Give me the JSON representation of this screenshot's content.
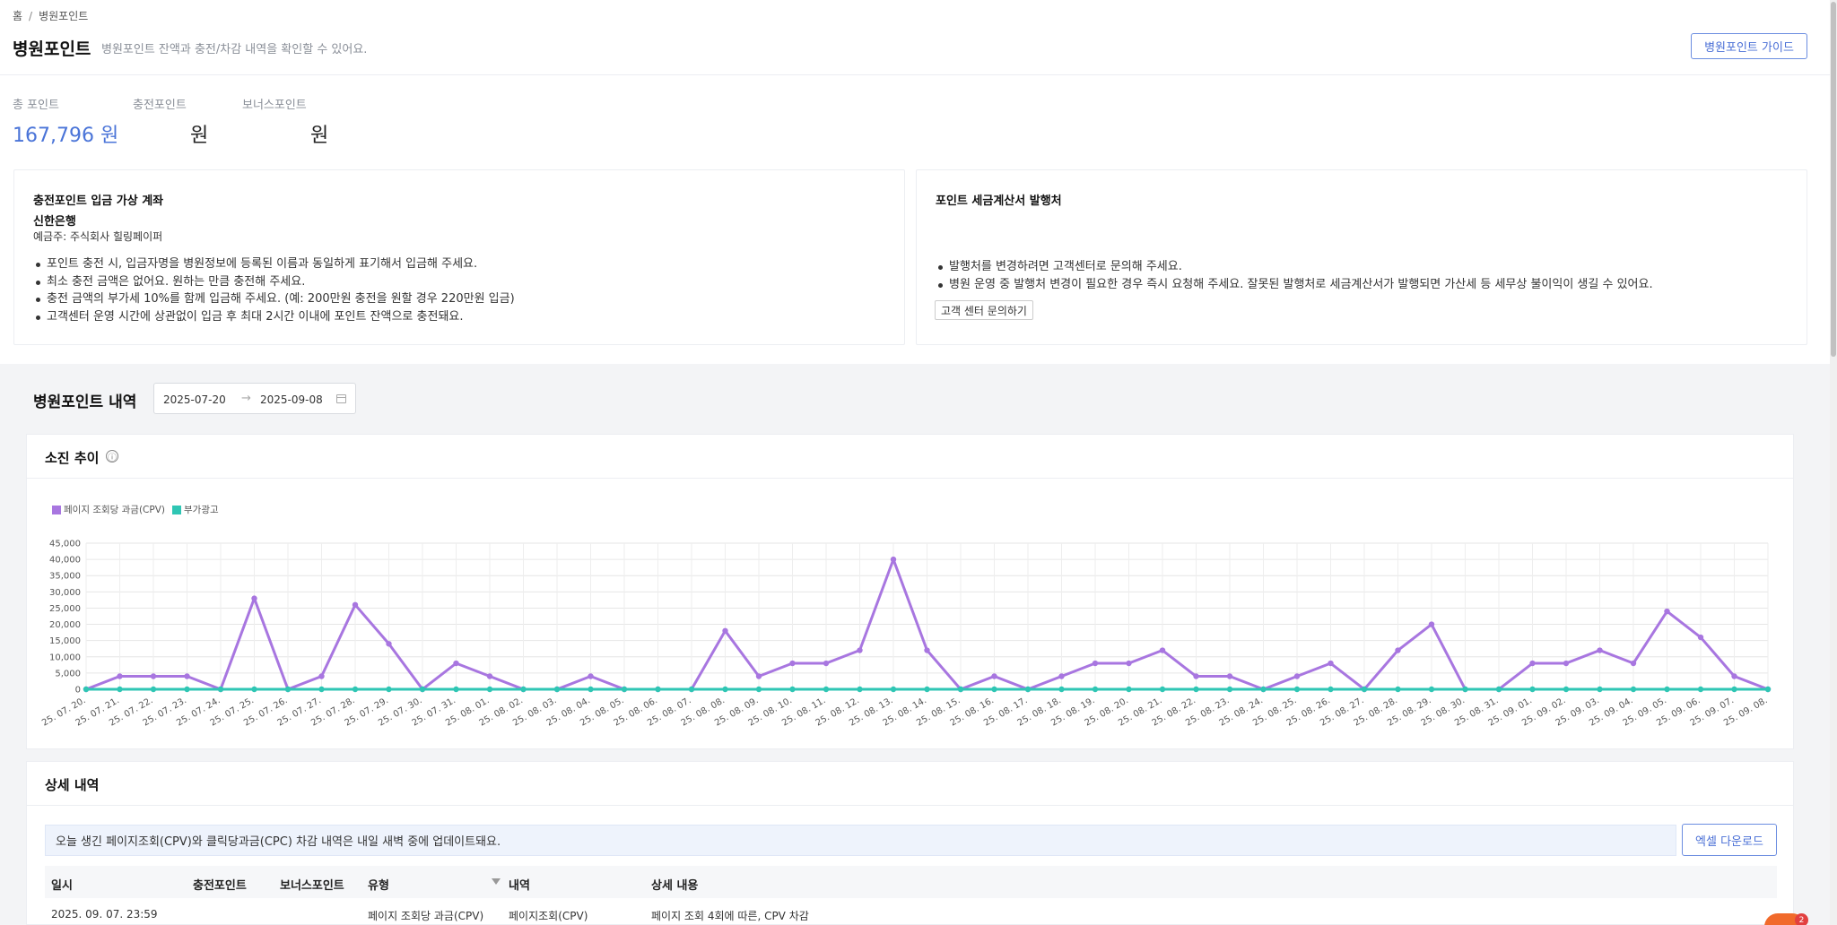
{
  "breadcrumb": {
    "home": "홈",
    "separator": "/",
    "current": "병원포인트"
  },
  "header": {
    "title": "병원포인트",
    "description": "병원포인트 잔액과 충전/차감 내역을 확인할 수 있어요.",
    "guide_button": "병원포인트 가이드"
  },
  "stats": {
    "total_label": "총 포인트",
    "total_value": "167,796 원",
    "charge_label": "충전포인트",
    "charge_value": "원",
    "bonus_label": "보너스포인트",
    "bonus_value": "원"
  },
  "deposit_card": {
    "title": "충전포인트 입금 가상 계좌",
    "bank": "신한은행",
    "holder": "예금주: 주식회사 힐링페이퍼",
    "bullets": [
      "포인트 충전 시, 입금자명을 병원정보에 등록된 이름과 동일하게 표기해서 입금해 주세요.",
      "최소 충전 금액은 없어요. 원하는 만큼 충전해 주세요.",
      "충전 금액의 부가세 10%를 함께 입금해 주세요. (예: 200만원 충전을 원할 경우 220만원 입금)",
      "고객센터 운영 시간에 상관없이 입금 후 최대 2시간 이내에 포인트 잔액으로 충전돼요."
    ]
  },
  "invoice_card": {
    "title": "포인트 세금계산서 발행처",
    "bullets": [
      "발행처를 변경하려면 고객센터로 문의해 주세요.",
      "병원 운영 중 발행처 변경이 필요한 경우 즉시 요청해 주세요. 잘못된 발행처로 세금계산서가 발행되면 가산세 등 세무상 불이익이 생길 수 있어요."
    ],
    "cs_button": "고객 센터 문의하기"
  },
  "history": {
    "title": "병원포인트 내역",
    "date_from": "2025-07-20",
    "date_arrow": "→",
    "date_to": "2025-09-08"
  },
  "trend_panel": {
    "title": "소진 추이",
    "info_icon": "ⓘ"
  },
  "colors": {
    "accent": "#4a74d8",
    "cpv": "#a876e0",
    "addon": "#2fc6b4"
  },
  "chart_data": {
    "type": "line",
    "x": [
      "25. 07. 20.",
      "25. 07. 21.",
      "25. 07. 22.",
      "25. 07. 23.",
      "25. 07. 24.",
      "25. 07. 25.",
      "25. 07. 26.",
      "25. 07. 27.",
      "25. 07. 28.",
      "25. 07. 29.",
      "25. 07. 30.",
      "25. 07. 31.",
      "25. 08. 01.",
      "25. 08. 02.",
      "25. 08. 03.",
      "25. 08. 04.",
      "25. 08. 05.",
      "25. 08. 06.",
      "25. 08. 07.",
      "25. 08. 08.",
      "25. 08. 09.",
      "25. 08. 10.",
      "25. 08. 11.",
      "25. 08. 12.",
      "25. 08. 13.",
      "25. 08. 14.",
      "25. 08. 15.",
      "25. 08. 16.",
      "25. 08. 17.",
      "25. 08. 18.",
      "25. 08. 19.",
      "25. 08. 20.",
      "25. 08. 21.",
      "25. 08. 22.",
      "25. 08. 23.",
      "25. 08. 24.",
      "25. 08. 25.",
      "25. 08. 26.",
      "25. 08. 27.",
      "25. 08. 28.",
      "25. 08. 29.",
      "25. 08. 30.",
      "25. 08. 31.",
      "25. 09. 01.",
      "25. 09. 02.",
      "25. 09. 03.",
      "25. 09. 04.",
      "25. 09. 05.",
      "25. 09. 06.",
      "25. 09. 07.",
      "25. 09. 08."
    ],
    "series": [
      {
        "name": "페이지 조회당 과금(CPV)",
        "color": "#a876e0",
        "values": [
          0,
          4000,
          4000,
          4000,
          0,
          28000,
          0,
          4000,
          26000,
          14000,
          0,
          8000,
          4000,
          0,
          0,
          4000,
          0,
          0,
          0,
          18000,
          4000,
          8000,
          8000,
          12000,
          40000,
          12000,
          0,
          4000,
          0,
          4000,
          8000,
          8000,
          12000,
          4000,
          4000,
          0,
          4000,
          8000,
          0,
          12000,
          20000,
          0,
          0,
          8000,
          8000,
          12000,
          8000,
          24000,
          16000,
          4000,
          0
        ]
      },
      {
        "name": "부가광고",
        "color": "#2fc6b4",
        "values": [
          0,
          0,
          0,
          0,
          0,
          0,
          0,
          0,
          0,
          0,
          0,
          0,
          0,
          0,
          0,
          0,
          0,
          0,
          0,
          0,
          0,
          0,
          0,
          0,
          0,
          0,
          0,
          0,
          0,
          0,
          0,
          0,
          0,
          0,
          0,
          0,
          0,
          0,
          0,
          0,
          0,
          0,
          0,
          0,
          0,
          0,
          0,
          0,
          0,
          0,
          0
        ]
      }
    ],
    "yticks": [
      "0",
      "5,000",
      "10,000",
      "15,000",
      "20,000",
      "25,000",
      "30,000",
      "35,000",
      "40,000",
      "45,000"
    ],
    "ylim": [
      0,
      45000
    ],
    "grid": true,
    "legend": "top-left"
  },
  "detail": {
    "title": "상세 내역",
    "notice": "오늘 생긴 페이지조회(CPV)와 클릭당과금(CPC) 차감 내역은 내일 새벽 중에 업데이트돼요.",
    "excel_button": "엑셀 다운로드",
    "columns": [
      "일시",
      "충전포인트",
      "보너스포인트",
      "유형",
      "내역",
      "상세 내용"
    ],
    "rows": [
      {
        "datetime": "2025. 09. 07. 23:59",
        "charge": "",
        "bonus": "",
        "type": "페이지 조회당 과금(CPV)",
        "item": "페이지조회(CPV)",
        "detail": "페이지 조회 4회에 따른, CPV 차감"
      }
    ]
  },
  "chat": {
    "badge": "2"
  }
}
